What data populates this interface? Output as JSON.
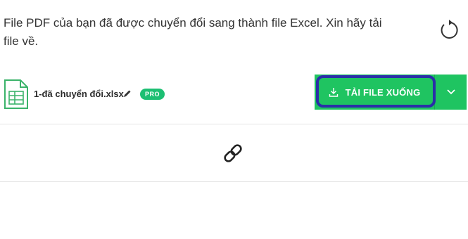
{
  "message": {
    "text": "File PDF của bạn đã được chuyển đổi sang thành file Excel. Xin hãy tải file về."
  },
  "file": {
    "name": "1-đã chuyển đổi.xlsx",
    "badge": "PRO",
    "icon": "spreadsheet-file-icon"
  },
  "actions": {
    "download_label": "TẢI FILE XUỐNG",
    "download_icon": "download-icon",
    "dropdown_icon": "chevron-down-icon",
    "restart_icon": "restart-icon",
    "link_icon": "link-icon",
    "edit_icon": "pencil-icon"
  },
  "colors": {
    "accent_green": "#1fc461",
    "badge_green": "#1dbf73",
    "highlight_border": "#2a2fa8"
  }
}
